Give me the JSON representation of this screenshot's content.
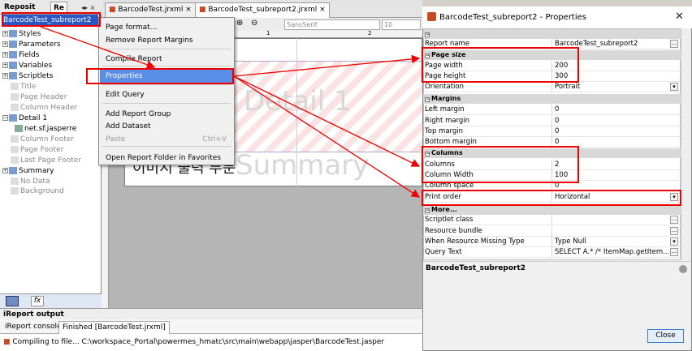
{
  "left_panel": {
    "tabs": [
      "Reposit",
      "Re"
    ],
    "root": "BarcodeTest_subreport2",
    "items": [
      {
        "label": "Styles",
        "expandable": true,
        "greyed": false
      },
      {
        "label": "Parameters",
        "expandable": true,
        "greyed": false
      },
      {
        "label": "Fields",
        "expandable": true,
        "greyed": false
      },
      {
        "label": "Variables",
        "expandable": true,
        "greyed": false
      },
      {
        "label": "Scriptlets",
        "expandable": true,
        "greyed": false
      },
      {
        "label": "Title",
        "expandable": false,
        "greyed": true
      },
      {
        "label": "Page Header",
        "expandable": false,
        "greyed": true
      },
      {
        "label": "Column Header",
        "expandable": false,
        "greyed": true
      },
      {
        "label": "Detail 1",
        "expandable": true,
        "greyed": false
      },
      {
        "label": "net.sf.jasperre",
        "expandable": false,
        "greyed": false,
        "child": true
      },
      {
        "label": "Column Footer",
        "expandable": false,
        "greyed": true
      },
      {
        "label": "Page Footer",
        "expandable": false,
        "greyed": true
      },
      {
        "label": "Last Page Footer",
        "expandable": false,
        "greyed": true
      },
      {
        "label": "Summary",
        "expandable": true,
        "greyed": false
      },
      {
        "label": "No Data",
        "expandable": false,
        "greyed": true
      },
      {
        "label": "Background",
        "expandable": false,
        "greyed": true
      }
    ],
    "bottom_icon_fx": "fx"
  },
  "editor": {
    "tabs": [
      "BarcodeTest.jrxml",
      "BarcodeTest_subreport2.jrxml"
    ],
    "font_field": "SansSerif",
    "size_field": "10",
    "ruler_marks": [
      "1",
      "2"
    ],
    "detail_label": "Detail 1",
    "summary_label": "Summary",
    "korean_text": "이미지 출력 부분"
  },
  "context_menu": {
    "items": [
      {
        "label": "Page format...",
        "shortcut": "",
        "disabled": false,
        "active": false
      },
      {
        "label": "Remove Report Margins",
        "shortcut": "",
        "disabled": false,
        "active": false
      },
      {
        "label": "Compile Report",
        "shortcut": "",
        "disabled": false,
        "active": false
      },
      {
        "label": "Properties",
        "shortcut": "",
        "disabled": false,
        "active": true
      },
      {
        "label": "Edit Query",
        "shortcut": "",
        "disabled": false,
        "active": false
      },
      {
        "label": "Add Report Group",
        "shortcut": "",
        "disabled": false,
        "active": false
      },
      {
        "label": "Add Dataset",
        "shortcut": "",
        "disabled": false,
        "active": false
      },
      {
        "label": "Paste",
        "shortcut": "Ctrl+V",
        "disabled": true,
        "active": false
      },
      {
        "label": "Open Report Folder in Favorites",
        "shortcut": "",
        "disabled": false,
        "active": false
      }
    ]
  },
  "output": {
    "title": "iReport output",
    "tabs": [
      "iReport console",
      "Finished [BarcodeTest.jrxml]"
    ],
    "line": "Compiling to file... C:\\workspace_Portal\\powermes_hmatc\\src\\main\\webapp\\jasper\\BarcodeTest.jasper"
  },
  "properties": {
    "title": "BarcodeTest_subreport2 - Properties",
    "rows": [
      {
        "kind": "cat",
        "label": ""
      },
      {
        "kind": "prop",
        "key": "Report name",
        "value": "BarcodeTest_subreport2",
        "control": "dots"
      },
      {
        "kind": "cat",
        "label": "Page size"
      },
      {
        "kind": "prop",
        "key": "Page width",
        "value": "200",
        "control": ""
      },
      {
        "kind": "prop",
        "key": "Page height",
        "value": "300",
        "control": ""
      },
      {
        "kind": "prop",
        "key": "Orientation",
        "value": "Portrait",
        "control": "dd"
      },
      {
        "kind": "cat",
        "label": "Margins"
      },
      {
        "kind": "prop",
        "key": "Left margin",
        "value": "0",
        "control": ""
      },
      {
        "kind": "prop",
        "key": "Right margin",
        "value": "0",
        "control": ""
      },
      {
        "kind": "prop",
        "key": "Top margin",
        "value": "0",
        "control": ""
      },
      {
        "kind": "prop",
        "key": "Bottom margin",
        "value": "0",
        "control": ""
      },
      {
        "kind": "cat",
        "label": "Columns"
      },
      {
        "kind": "prop",
        "key": "Columns",
        "value": "2",
        "control": ""
      },
      {
        "kind": "prop",
        "key": "Column Width",
        "value": "100",
        "control": ""
      },
      {
        "kind": "prop",
        "key": "Column space",
        "value": "0",
        "control": ""
      },
      {
        "kind": "prop",
        "key": "Print order",
        "value": "Horizontal",
        "control": "dd"
      },
      {
        "kind": "cat",
        "label": "More..."
      },
      {
        "kind": "prop",
        "key": "Scriptlet class",
        "value": "",
        "control": "dots"
      },
      {
        "kind": "prop",
        "key": "Resource bundle",
        "value": "",
        "control": "dots"
      },
      {
        "kind": "prop",
        "key": "When Resource Missing Type",
        "value": "Type Null",
        "control": "dd"
      },
      {
        "kind": "prop",
        "key": "Query Text",
        "value": "SELECT A.* /* ItemMap.getItem...",
        "control": "dots"
      }
    ],
    "description_title": "BarcodeTest_subreport2",
    "close_label": "Close"
  },
  "colors": {
    "selection": "#2a57c4",
    "menu_highlight": "#5b8ee6",
    "annotation_red": "#e00000"
  }
}
